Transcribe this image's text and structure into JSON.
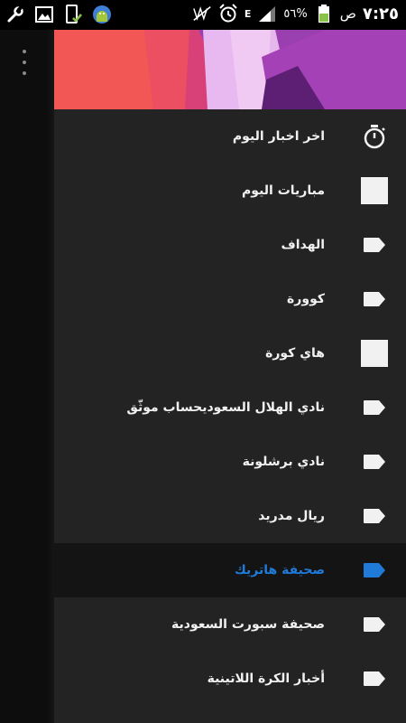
{
  "status_bar": {
    "time": "٧:٢٥",
    "ampm": "ص",
    "battery": "٥٦%",
    "network": "E",
    "icons_left": [
      "wrench-icon",
      "image-icon",
      "phone-check-icon",
      "android-icon"
    ],
    "icons_right": [
      "mute-icon",
      "alarm-icon",
      "signal-icon",
      "battery-icon"
    ]
  },
  "overflow_menu": {
    "icon": "more-vertical-icon"
  },
  "menu": {
    "items": [
      {
        "label": "اخر اخبار اليوم",
        "icon": "stopwatch-icon"
      },
      {
        "label": "مباريات اليوم",
        "icon": "square-icon"
      },
      {
        "label": "الهداف",
        "icon": "tag-icon"
      },
      {
        "label": "كوورة",
        "icon": "tag-icon"
      },
      {
        "label": "هاي كورة",
        "icon": "square-icon"
      },
      {
        "label": "نادي الهلال السعوديحساب موثّق",
        "icon": "tag-icon"
      },
      {
        "label": "نادي برشلونة",
        "icon": "tag-icon"
      },
      {
        "label": "ريال مدريد",
        "icon": "tag-icon"
      },
      {
        "label": "صحيفة هاتريك",
        "icon": "tag-icon",
        "selected": true
      },
      {
        "label": "صحيفة سبورت السعودية",
        "icon": "tag-icon"
      },
      {
        "label": "أخبار الكرة اللاتينية",
        "icon": "tag-icon"
      }
    ]
  },
  "colors": {
    "drawer_bg": "#232323",
    "selected_bg": "#141414",
    "accent": "#1f7ad8",
    "text": "#f1f1f1"
  }
}
